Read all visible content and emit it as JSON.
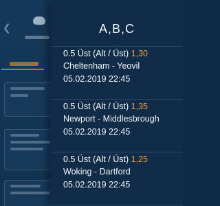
{
  "drawer": {
    "title": "A,B,C"
  },
  "matches": [
    {
      "market": "0.5 Üst (Alt / Üst)",
      "odds": "1,30",
      "teams": "Cheltenham - Yeovil",
      "date": "05.02.2019 22:45"
    },
    {
      "market": "0.5 Üst (Alt / Üst)",
      "odds": "1,35",
      "teams": "Newport - Middlesbrough",
      "date": "05.02.2019 22:45"
    },
    {
      "market": "0.5 Üst (Alt / Üst)",
      "odds": "1,25",
      "teams": "Woking - Dartford",
      "date": "05.02.2019 22:45"
    }
  ],
  "icons": {
    "back": "chevron-left-icon",
    "sport": "football-icon"
  },
  "colors": {
    "background": "#11304d",
    "drawer": "#102c49",
    "odds": "#f0a23a",
    "divider": "#2a4a68",
    "text": "#ffffff"
  }
}
